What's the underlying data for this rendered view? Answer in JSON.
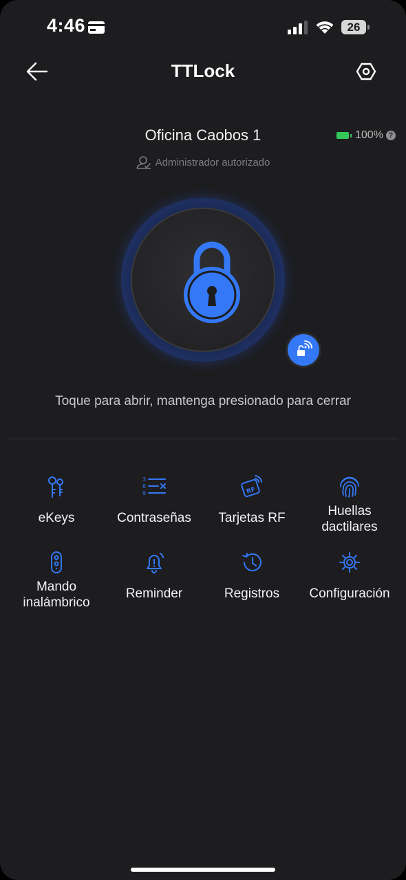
{
  "status_bar": {
    "time": "4:46",
    "battery_level": "26"
  },
  "nav": {
    "title": "TTLock"
  },
  "lock": {
    "name": "Oficina Caobos 1",
    "battery_percent": "100%",
    "role": "Administrador autorizado",
    "hint": "Toque para abrir, mantenga presionado para cerrar"
  },
  "colors": {
    "accent": "#3478f6",
    "background": "#1d1d1f",
    "battery_green": "#34c759"
  },
  "features": [
    {
      "label": "eKeys",
      "icon": "key-icon"
    },
    {
      "label": "Contraseñas",
      "icon": "passcode-icon"
    },
    {
      "label": "Tarjetas RF",
      "icon": "rf-card-icon"
    },
    {
      "label": "Huellas dactilares",
      "icon": "fingerprint-icon"
    },
    {
      "label": "Mando inalámbrico",
      "icon": "remote-icon"
    },
    {
      "label": "Reminder",
      "icon": "bell-icon"
    },
    {
      "label": "Registros",
      "icon": "history-icon"
    },
    {
      "label": "Configuración",
      "icon": "gear-icon"
    }
  ]
}
